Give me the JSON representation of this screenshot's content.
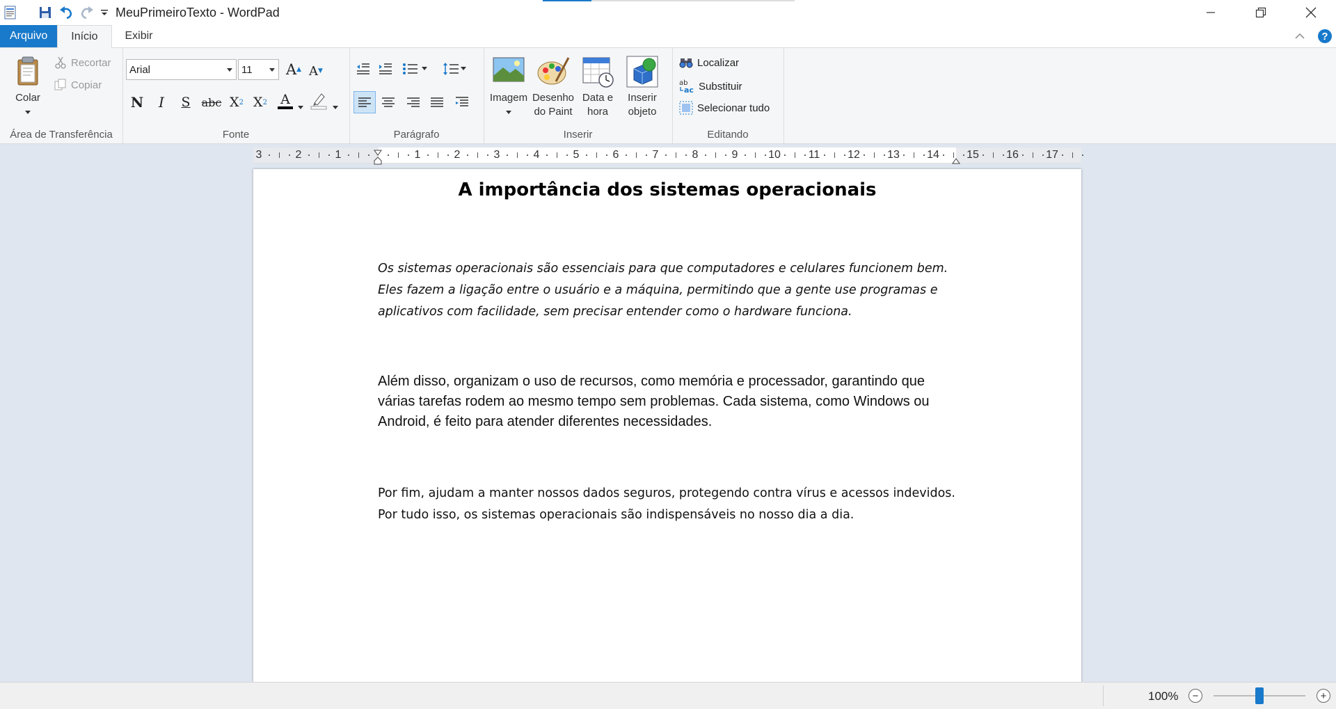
{
  "window": {
    "title": "MeuPrimeiroTexto - WordPad",
    "app_icon": "wordpad-icon",
    "quick_access": [
      "save-icon",
      "undo-icon",
      "redo-icon",
      "customize-quick-access-icon"
    ],
    "controls": [
      "minimize",
      "restore",
      "close"
    ]
  },
  "tabs": {
    "file": "Arquivo",
    "home": "Início",
    "view": "Exibir",
    "active": "Início"
  },
  "ribbon": {
    "clipboard": {
      "label": "Área de Transferência",
      "paste": "Colar",
      "cut": "Recortar",
      "copy": "Copiar"
    },
    "font": {
      "label": "Fonte",
      "family": "Arial",
      "size": "11",
      "grow": "A",
      "shrink": "A",
      "bold": "N",
      "italic": "I",
      "underline": "S",
      "strikethrough": "abc",
      "subscript": "X",
      "subscript_mark": "2",
      "superscript": "X",
      "superscript_mark": "2",
      "text_color": "A",
      "text_color_value": "#000000",
      "highlight_color_value": "#ffffff"
    },
    "paragraph": {
      "label": "Parágrafo",
      "alignment": "left"
    },
    "insert": {
      "label": "Inserir",
      "image": "Imagem",
      "paint_l1": "Desenho",
      "paint_l2": "do Paint",
      "datetime_l1": "Data e",
      "datetime_l2": "hora",
      "object_l1": "Inserir",
      "object_l2": "objeto"
    },
    "editing": {
      "label": "Editando",
      "find": "Localizar",
      "replace": "Substituir",
      "select_all": "Selecionar tudo"
    }
  },
  "ruler": {
    "labels": [
      "3",
      "2",
      "1",
      "1",
      "2",
      "3",
      "4",
      "5",
      "6",
      "7",
      "8",
      "9",
      "10",
      "11",
      "12",
      "13",
      "14",
      "15",
      "16",
      "17"
    ]
  },
  "document": {
    "title": "A importância dos sistemas operacionais",
    "paragraph1": "Os sistemas operacionais são essenciais para que computadores e celulares funcionem bem. Eles fazem a ligação entre o usuário e a máquina, permitindo que a gente use programas e aplicativos com facilidade, sem precisar entender como o hardware funciona.",
    "paragraph2": "Além disso, organizam o uso de recursos, como memória e processador, garantindo que várias tarefas rodem ao mesmo tempo sem problemas. Cada sistema, como Windows ou Android, é feito para atender diferentes necessidades.",
    "paragraph3": "Por fim, ajudam a manter nossos dados seguros, protegendo contra vírus e acessos indevidos. Por tudo isso, os sistemas operacionais são indispensáveis no nosso dia a dia."
  },
  "status": {
    "zoom": "100%",
    "zoom_out": "−",
    "zoom_in": "+",
    "zoom_level_fraction": 0.5
  },
  "colors": {
    "accent": "#1979ca",
    "ribbon_bg": "#f5f6f7",
    "workspace_bg": "#dfe6f0"
  }
}
